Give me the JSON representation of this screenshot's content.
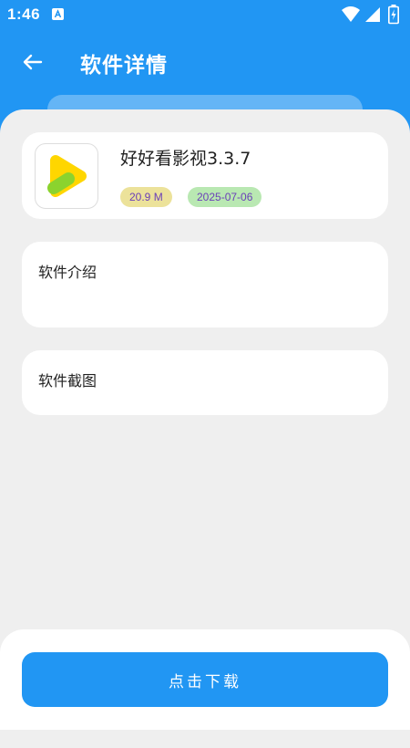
{
  "status_bar": {
    "time": "1:46",
    "icons": [
      "notification-app-icon",
      "wifi-icon",
      "signal-icon",
      "battery-charging-icon"
    ]
  },
  "header": {
    "title": "软件详情",
    "back_icon": "arrow-left-icon"
  },
  "app": {
    "name": "好好看影视3.3.7",
    "size": "20.9 M",
    "date": "2025-07-06",
    "icon": "play-triangle-logo"
  },
  "sections": {
    "intro_title": "软件介绍",
    "screenshots_title": "软件截图"
  },
  "actions": {
    "download_label": "点击下载"
  },
  "colors": {
    "primary": "#2196f3",
    "sheet_background": "#efefef",
    "card_background": "#ffffff",
    "size_badge": "#ece29a",
    "date_badge": "#b9e8b2",
    "badge_text": "#6a3fb8"
  }
}
